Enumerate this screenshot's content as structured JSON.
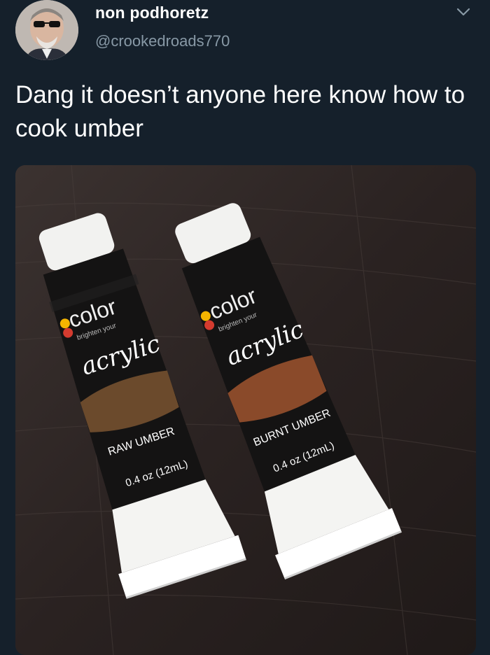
{
  "tweet": {
    "author": {
      "display_name": "non podhoretz",
      "handle": "@crookedroads770",
      "avatar_icon": "avatar-photo"
    },
    "menu_icon": "chevron-down-icon",
    "text": "Dang it doesn’t anyone here know how to cook umber",
    "photo": {
      "tubes": [
        {
          "brand": "color",
          "tagline": "brighten your",
          "type": "acrylic",
          "color_name": "RAW UMBER",
          "size": "0.4 oz (12mL)",
          "swatch_color": "#6b4a2c"
        },
        {
          "brand": "color",
          "tagline": "brighten your",
          "type": "acrylic",
          "color_name": "BURNT UMBER",
          "size": "0.4 oz (12mL)",
          "swatch_color": "#8a4a2a"
        }
      ]
    }
  },
  "colors": {
    "background": "#15202b",
    "secondary_text": "#8899a6"
  }
}
